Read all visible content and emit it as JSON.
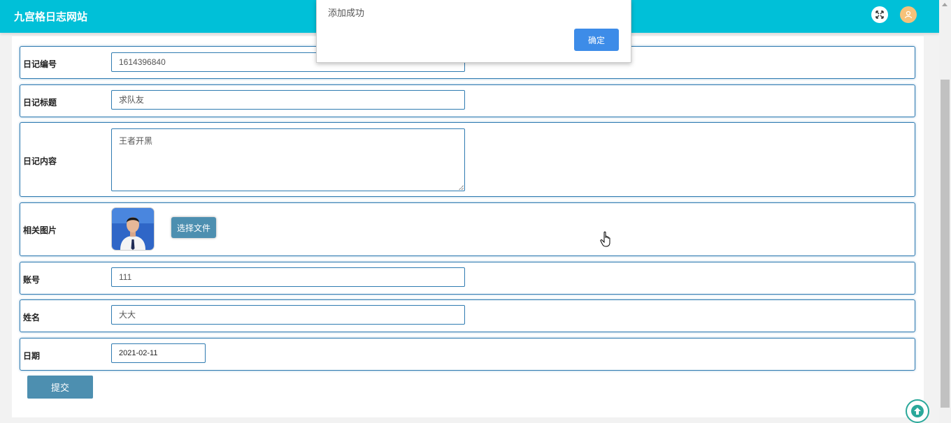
{
  "header": {
    "site_title": "九宫格日志网站",
    "fullscreen_icon": "expand-arrows-icon",
    "user_icon": "user-icon"
  },
  "form": {
    "fields": [
      {
        "label": "日记编号",
        "value": "1614396840"
      },
      {
        "label": "日记标题",
        "value": "求队友"
      },
      {
        "label": "日记内容",
        "value": "王者开黑"
      },
      {
        "label": "相关图片",
        "button": "选择文件"
      },
      {
        "label": "账号",
        "value": "111"
      },
      {
        "label": "姓名",
        "value": "大大"
      },
      {
        "label": "日期",
        "value": "2021-02-11"
      }
    ],
    "submit_label": "提交"
  },
  "dialog": {
    "message": "添加成功",
    "ok_label": "确定"
  },
  "colors": {
    "header_bg": "#00c0d8",
    "border": "#2f7bb1",
    "button": "#4d8fb0",
    "dialog_ok": "#3d8ce8"
  }
}
